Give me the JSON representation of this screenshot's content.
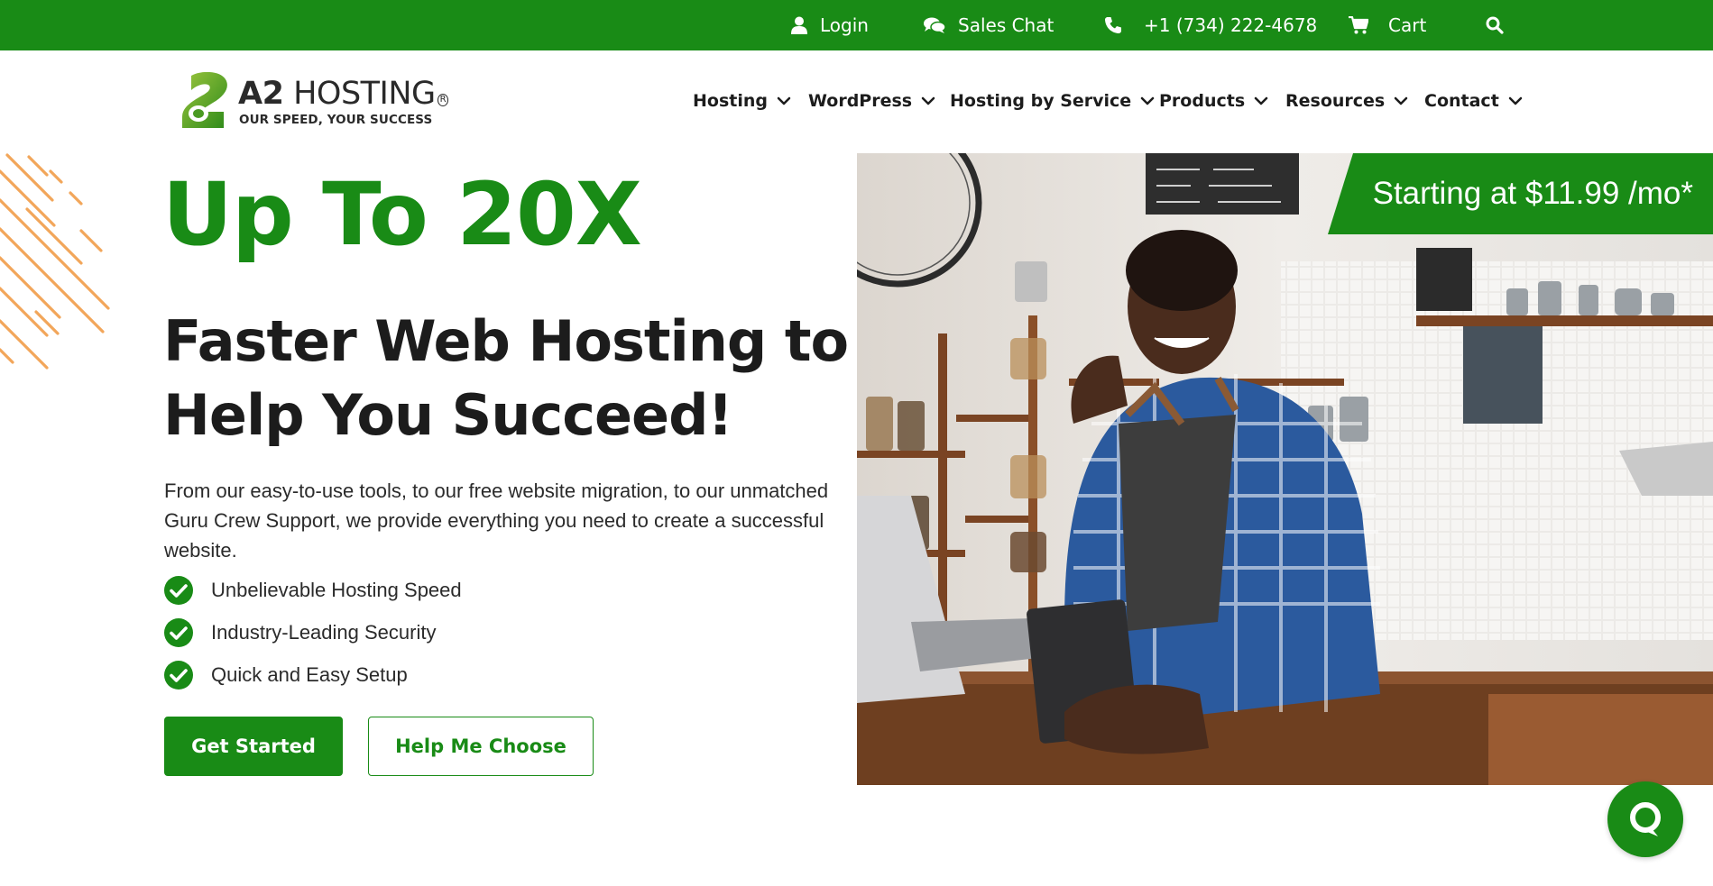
{
  "topbar": {
    "login_label": "Login",
    "sales_chat_label": "Sales Chat",
    "phone_label": "+1 (734) 222-4678",
    "cart_label": "Cart"
  },
  "logo": {
    "brand_bold": "A2",
    "brand_rest": " HOSTING",
    "tagline": "OUR SPEED, YOUR SUCCESS"
  },
  "nav": {
    "items": [
      {
        "label": "Hosting"
      },
      {
        "label": "WordPress"
      },
      {
        "label": "Hosting by Service"
      },
      {
        "label": "Products"
      },
      {
        "label": "Resources"
      },
      {
        "label": "Contact"
      }
    ]
  },
  "hero": {
    "headline_accent": "Up To 20X",
    "headline": "Faster Web Hosting to Help You Succeed!",
    "intro": "From our easy-to-use tools, to our free website migration, to our unmatched Guru Crew Support, we provide everything you need to create a successful website.",
    "features": [
      "Unbelievable Hosting Speed",
      "Industry-Leading Security",
      "Quick and Easy Setup"
    ],
    "primary_cta": "Get Started",
    "secondary_cta": "Help Me Choose",
    "price_banner": "Starting at $11.99 /mo*"
  },
  "colors": {
    "brand_green": "#198b16",
    "accent_orange": "#f2a65a",
    "text_dark": "#1c1c1c"
  },
  "icons": [
    "user-icon",
    "chat-bubbles-icon",
    "phone-icon",
    "cart-icon",
    "search-icon",
    "chevron-down-icon",
    "check-circle-icon",
    "chat-icon"
  ]
}
